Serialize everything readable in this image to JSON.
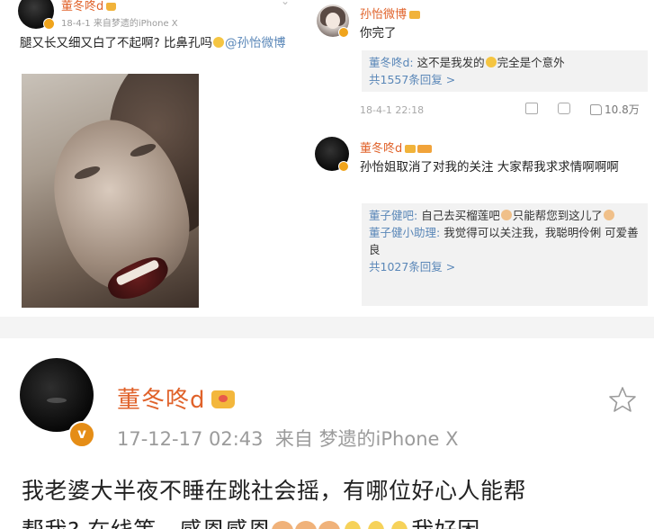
{
  "left_post": {
    "name": "董冬咚d",
    "meta": "18-4-1 来自梦遗的iPhone X",
    "text": "腿又长又细又白了不起啊? 比鼻孔吗",
    "mention": "@孙怡微博"
  },
  "comments": [
    {
      "name": "孙怡微博",
      "text": "你完了",
      "replies": [
        {
          "name": "董冬咚d:",
          "text": " 这不是我发的",
          "text2": "完全是个意外"
        }
      ],
      "more": "共1557条回复 >",
      "time": "18-4-1 22:18",
      "likes": "10.8万"
    },
    {
      "name": "董冬咚d",
      "text": "孙怡姐取消了对我的关注 大家帮我求求情啊啊啊",
      "replies": [
        {
          "name": "董子健吧:",
          "text": " 自己去买榴莲吧",
          "text2": "只能帮您到这儿了"
        },
        {
          "name": "董子健小助理:",
          "text": " 我觉得可以关注我，我聪明伶俐 可爱善良"
        }
      ],
      "more": "共1027条回复 >"
    }
  ],
  "bottom_post": {
    "name": "董冬咚d",
    "badge": "v",
    "time": "17-12-17 02:43",
    "source_prefix": "来自",
    "source": "梦遗的iPhone X",
    "text_line1": "我老婆大半夜不睡在跳社会摇，有哪位好心人能帮",
    "text_line2a": "帮我? 在线等，感恩感恩",
    "text_line2b": "我好困"
  },
  "colors": {
    "name_orange": "#e0622a",
    "link_blue": "#5a87b8",
    "meta_gray": "#9b9b9b",
    "badge_orange": "#f0a41c"
  },
  "icons": [
    "chevron-down-icon",
    "share-icon",
    "comment-icon",
    "like-icon",
    "star-icon",
    "crown-icon",
    "verified-badge-icon"
  ]
}
